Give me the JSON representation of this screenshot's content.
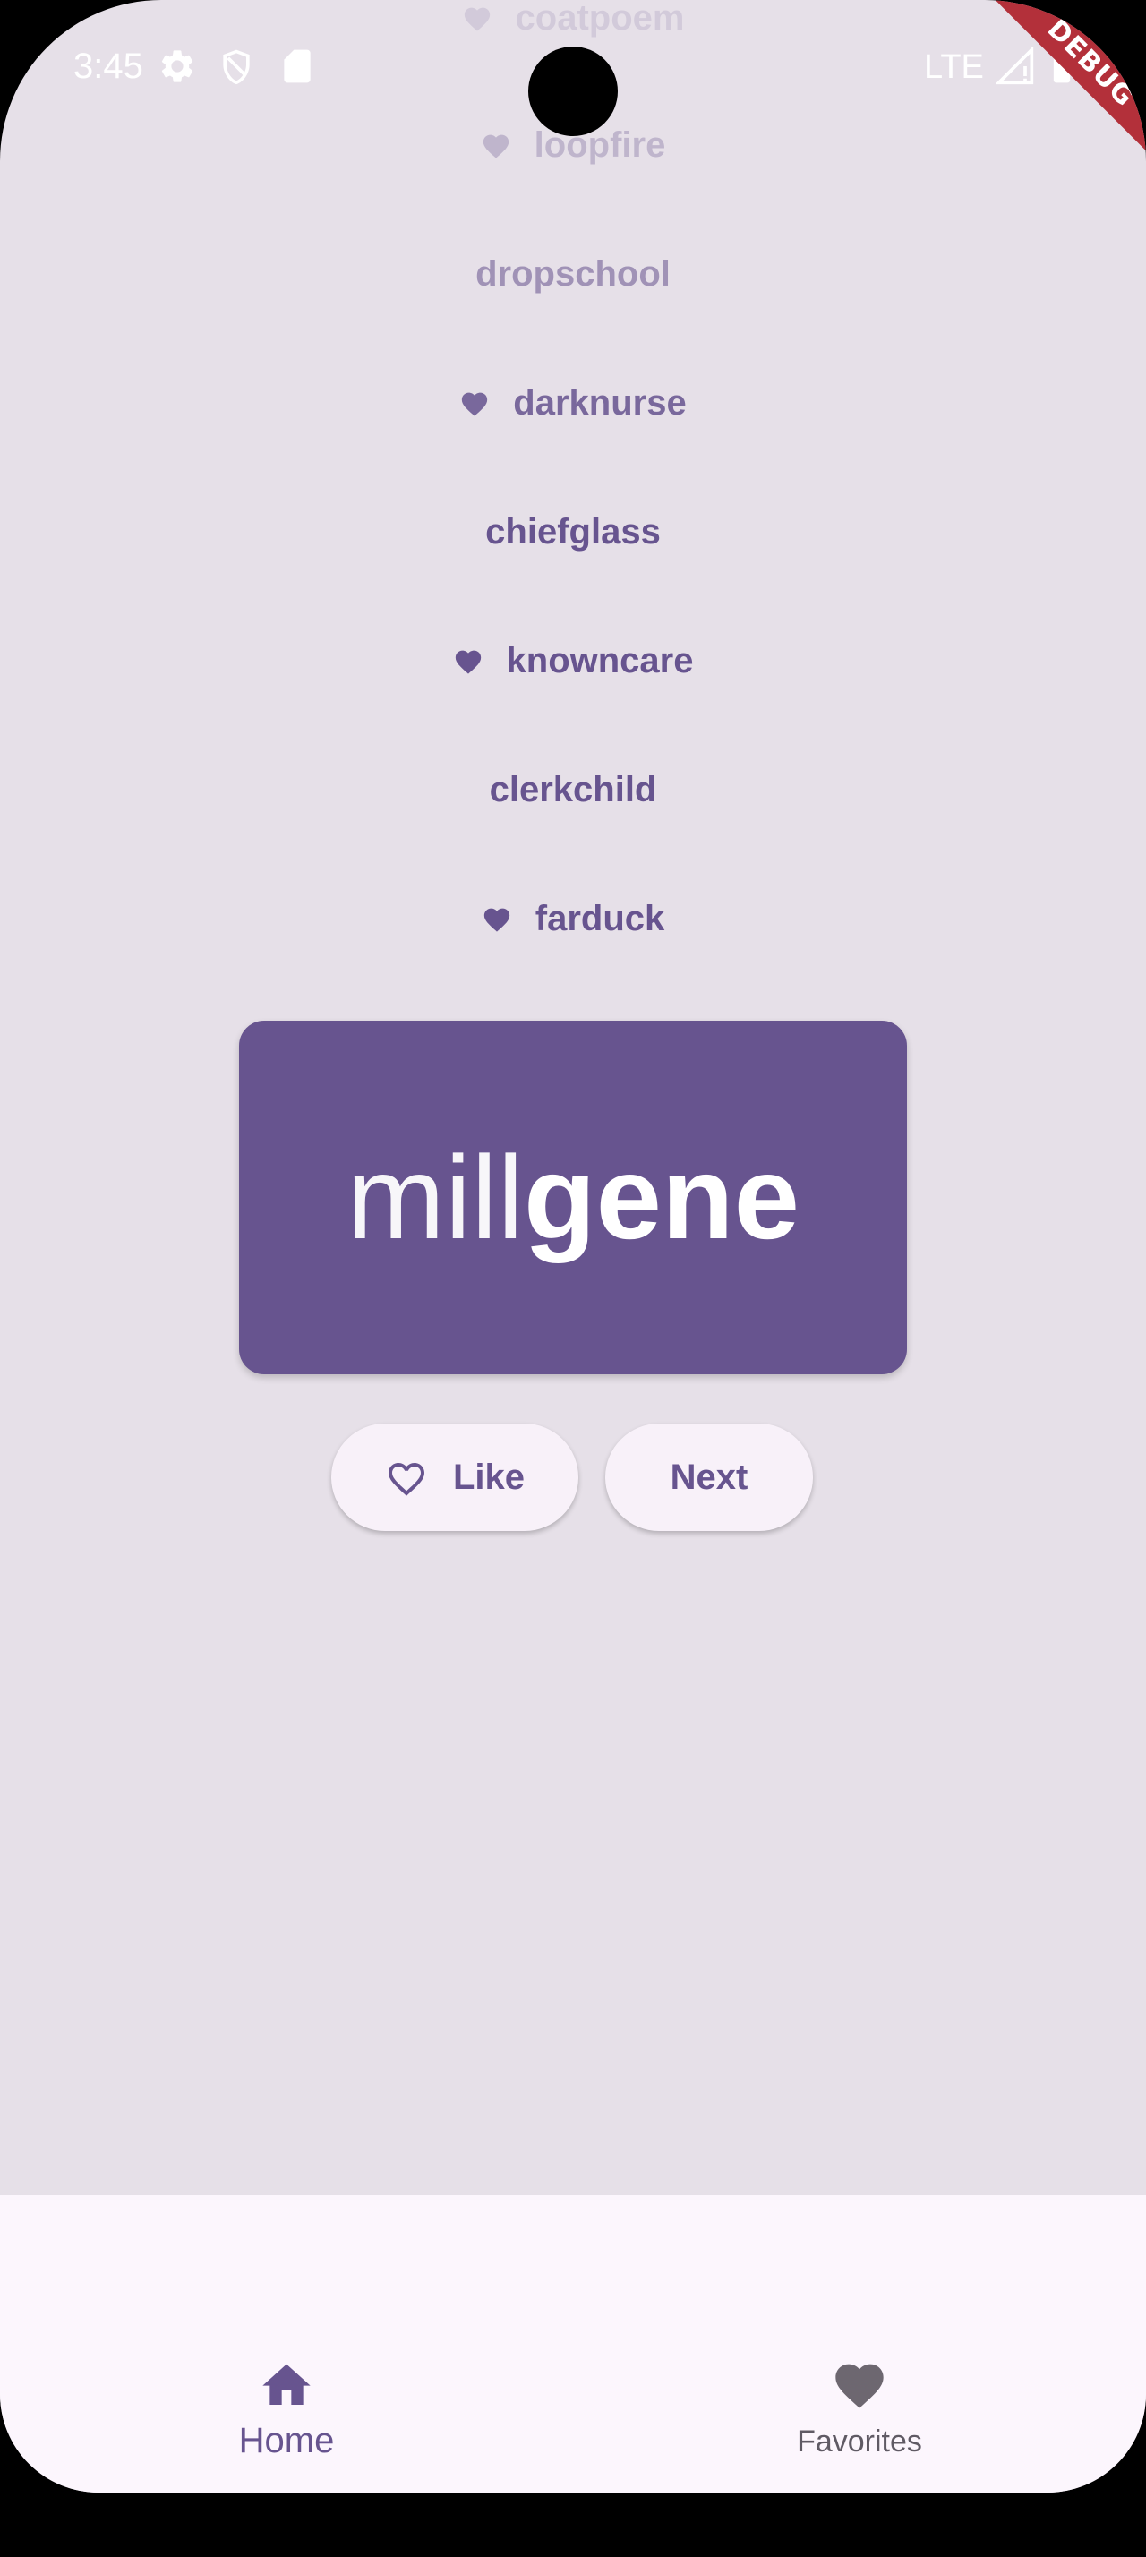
{
  "status_bar": {
    "time": "3:45",
    "network": "LTE",
    "icons": [
      "settings-gear-icon",
      "shield-icon",
      "sd-card-icon",
      "signal-icon",
      "battery-icon"
    ]
  },
  "debug_banner": "DEBUG",
  "history": [
    {
      "name": "coatpoem",
      "favorite": true,
      "opacity": 0.15
    },
    {
      "name": "loopfire",
      "favorite": true,
      "opacity": 0.3
    },
    {
      "name": "dropschool",
      "favorite": false,
      "opacity": 0.55
    },
    {
      "name": "darknurse",
      "favorite": true,
      "opacity": 0.85
    },
    {
      "name": "chiefglass",
      "favorite": false,
      "opacity": 1
    },
    {
      "name": "knowncare",
      "favorite": true,
      "opacity": 1
    },
    {
      "name": "clerkchild",
      "favorite": false,
      "opacity": 1
    },
    {
      "name": "farduck",
      "favorite": true,
      "opacity": 1
    }
  ],
  "current_pair": {
    "first": "mill",
    "second": "gene"
  },
  "actions": {
    "like_label": "Like",
    "next_label": "Next"
  },
  "nav": {
    "home_label": "Home",
    "favorites_label": "Favorites",
    "selected": "home"
  },
  "colors": {
    "primary": "#67548f",
    "background": "#e6e0e8",
    "nav_background": "#fcf6fd",
    "button_background": "#f8f1f9"
  }
}
